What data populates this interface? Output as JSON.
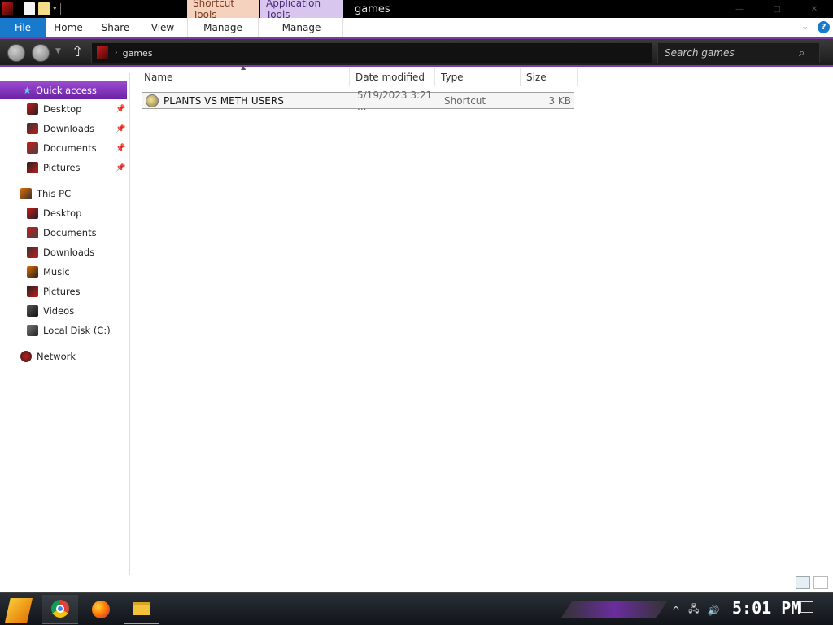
{
  "window": {
    "title": "games",
    "contextual_tabs": [
      "Shortcut Tools",
      "Application Tools"
    ],
    "controls": {
      "minimize": "—",
      "maximize": "□",
      "close": "✕"
    }
  },
  "ribbon": {
    "tabs": [
      "File",
      "Home",
      "Share",
      "View",
      "Manage",
      "Manage"
    ],
    "help": "?",
    "expand": "⌄"
  },
  "address": {
    "path": "games",
    "search_placeholder": "Search games"
  },
  "sidebar": {
    "quick_access": {
      "label": "Quick access",
      "items": [
        {
          "label": "Desktop",
          "pinned": true
        },
        {
          "label": "Downloads",
          "pinned": true
        },
        {
          "label": "Documents",
          "pinned": true
        },
        {
          "label": "Pictures",
          "pinned": true
        }
      ]
    },
    "this_pc": {
      "label": "This PC",
      "items": [
        {
          "label": "Desktop"
        },
        {
          "label": "Documents"
        },
        {
          "label": "Downloads"
        },
        {
          "label": "Music"
        },
        {
          "label": "Pictures"
        },
        {
          "label": "Videos"
        },
        {
          "label": "Local Disk (C:)"
        }
      ]
    },
    "network": {
      "label": "Network"
    }
  },
  "content": {
    "columns": [
      "Name",
      "Date modified",
      "Type",
      "Size"
    ],
    "files": [
      {
        "name": "PLANTS VS METH USERS",
        "date_modified": "5/19/2023 3:21 ...",
        "type": "Shortcut",
        "size": "3 KB"
      }
    ]
  },
  "taskbar": {
    "apps": [
      "Google Chrome",
      "Firefox",
      "File Explorer"
    ],
    "tray": {
      "chevron": "^",
      "network": "🖧",
      "volume": "🔊"
    },
    "clock": "5:01 PM"
  },
  "colors": {
    "accent": "#7c3aa3",
    "file_tab": "#1979ca",
    "shortcut_tools": "#f4d2bd",
    "application_tools": "#d9c6ee"
  }
}
